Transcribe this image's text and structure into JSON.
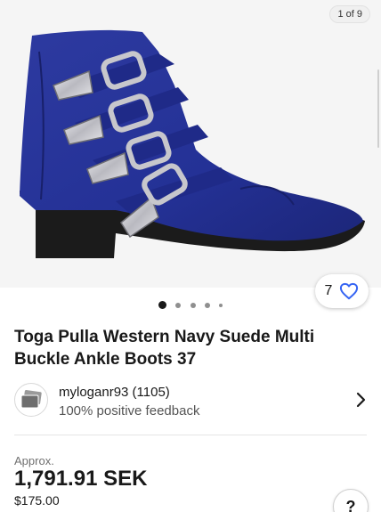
{
  "gallery": {
    "counter": "1 of 9",
    "product_image_icon": "navy-suede-buckle-ankle-boot-photo"
  },
  "carousel": {
    "total_dots": 5,
    "active_index": 0
  },
  "watch": {
    "count": "7",
    "icon": "heart-icon"
  },
  "listing": {
    "title": "Toga Pulla Western Navy Suede Multi Buckle Ankle Boots 37"
  },
  "seller": {
    "name": "myloganr93 (1105)",
    "feedback": "100% positive feedback",
    "avatar_icon": "seller-avatar-icon"
  },
  "price": {
    "approx_label": "Approx.",
    "converted": "1,791.91 SEK",
    "original": "$175.00"
  },
  "help": {
    "label": "?"
  },
  "colors": {
    "boot_navy": "#232f8c",
    "sole_black": "#1b1b1b",
    "buckle_silver": "#c8c8cc"
  }
}
